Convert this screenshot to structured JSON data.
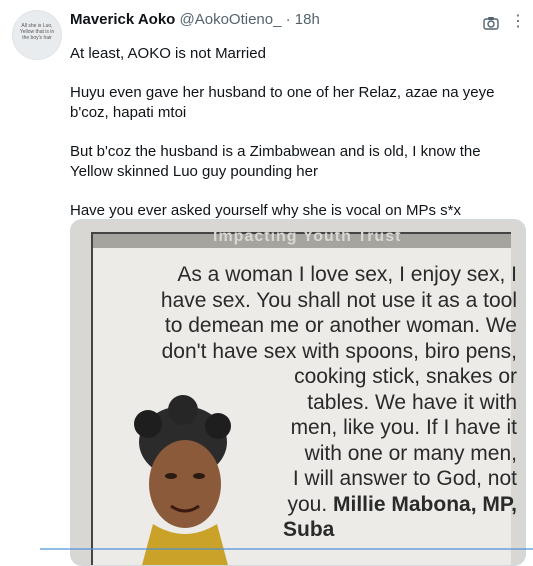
{
  "tweet": {
    "display_name": "Maverick Aoko",
    "handle": "@AokoOtieno_",
    "separator": "·",
    "time": "18h",
    "paragraphs": [
      "At least, AOKO is not Married",
      "Huyu even gave her husband to one of her Relaz, azae na yeye b'coz, hapati mtoi",
      "But b'coz the husband is a Zimbabwean and is old, I know the Yellow skinned Luo guy pounding her",
      "Have you ever asked yourself why she is vocal on MPs s*x scandals?"
    ]
  },
  "avatar": {
    "caption": "All she is Luo, Yellow that is in the boy's hair"
  },
  "media": {
    "header_strip": "Impacting Youth Trust",
    "quote_lines": [
      "As a woman I love sex, I enjoy sex, I",
      "have sex. You shall not use it as a tool",
      "to demean me or another woman. We",
      "don't have sex with spoons, biro pens,",
      "cooking stick, snakes or",
      "tables. We have it with",
      "men, like you. If I have it",
      "with one or many men,",
      "I will answer to God, not"
    ],
    "attribution_prefix": "you.",
    "attribution": "Millie Mabona, MP,",
    "party": "Suba"
  },
  "icons": {
    "camera": "camera-icon",
    "more": "more-options-icon"
  }
}
